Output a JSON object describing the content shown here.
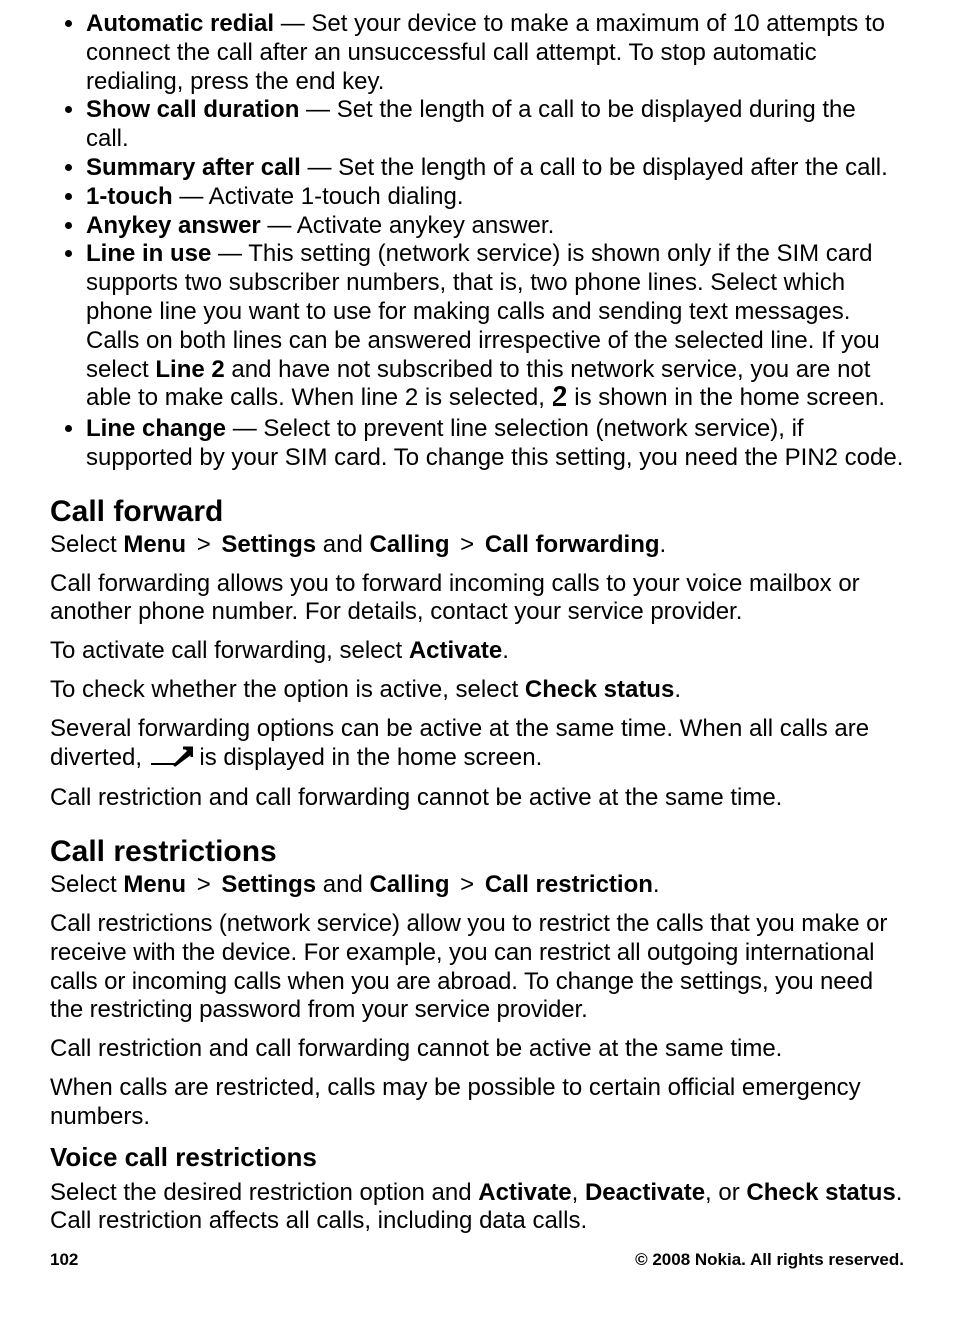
{
  "bullets": {
    "auto_redial": {
      "label": "Automatic redial",
      "text": " — Set your device to make a maximum of 10 attempts to connect the call after an unsuccessful call attempt. To stop automatic redialing, press the end key."
    },
    "show_call_dur": {
      "label": "Show call duration",
      "text": " — Set the length of a call to be displayed during the call."
    },
    "summary_after": {
      "label": "Summary after call",
      "text": " — Set the length of a call to be displayed after the call."
    },
    "one_touch": {
      "label": "1-touch",
      "text": " — Activate 1-touch dialing."
    },
    "anykey": {
      "label": "Anykey answer",
      "text": " — Activate anykey answer."
    },
    "line_in_use": {
      "label": "Line in use",
      "text1": " — This setting (network service) is shown only if the SIM card supports two subscriber numbers, that is, two phone lines. Select which phone line you want to use for making calls and sending text messages. Calls on both lines can be answered irrespective of the selected line. If you select ",
      "bold_line2": "Line 2",
      "text2": " and have not subscribed to this network service, you are not able to make calls. When line 2 is selected, ",
      "text3": " is shown in the home screen."
    },
    "line_change": {
      "label": "Line change",
      "text": " — Select to prevent line selection (network service), if supported by your SIM card. To change this setting, you need the PIN2 code."
    }
  },
  "callforward": {
    "title": "Call forward",
    "nav": {
      "select": "Select ",
      "menu": "Menu",
      "sep": ">",
      "settings": "Settings",
      "and": " and ",
      "calling": "Calling",
      "forwarding": "Call forwarding",
      "dot": "."
    },
    "p1": "Call forwarding allows you to forward incoming calls to your voice mailbox or another phone number. For details, contact your service provider.",
    "p2a": "To activate call forwarding, select ",
    "p2b": "Activate",
    "p2c": ".",
    "p3a": "To check whether the option is active, select ",
    "p3b": "Check status",
    "p3c": ".",
    "p4a": "Several forwarding options can be active at the same time. When all calls are diverted, ",
    "p4b": " is displayed in the home screen.",
    "p5": "Call restriction and call forwarding cannot be active at the same time."
  },
  "callrestrict": {
    "title": "Call restrictions",
    "nav": {
      "select": "Select ",
      "menu": "Menu",
      "sep": ">",
      "settings": "Settings",
      "and": " and ",
      "calling": "Calling",
      "restriction": "Call restriction",
      "dot": "."
    },
    "p1": "Call restrictions (network service) allow you to restrict the calls that you make or receive with the device. For example, you can restrict all outgoing international calls or incoming calls when you are abroad. To change the settings, you need the restricting password from your service provider.",
    "p2": "Call restriction and call forwarding cannot be active at the same time.",
    "p3": "When calls are restricted, calls may be possible to certain official emergency numbers.",
    "subtitle": "Voice call restrictions",
    "p4a": "Select the desired restriction option and ",
    "p4b": "Activate",
    "p4c": ", ",
    "p4d": "Deactivate",
    "p4e": ", or ",
    "p4f": "Check status",
    "p4g": ". Call restriction affects all calls, including data calls."
  },
  "footer": {
    "page": "102",
    "copyright": "© 2008 Nokia. All rights reserved."
  }
}
